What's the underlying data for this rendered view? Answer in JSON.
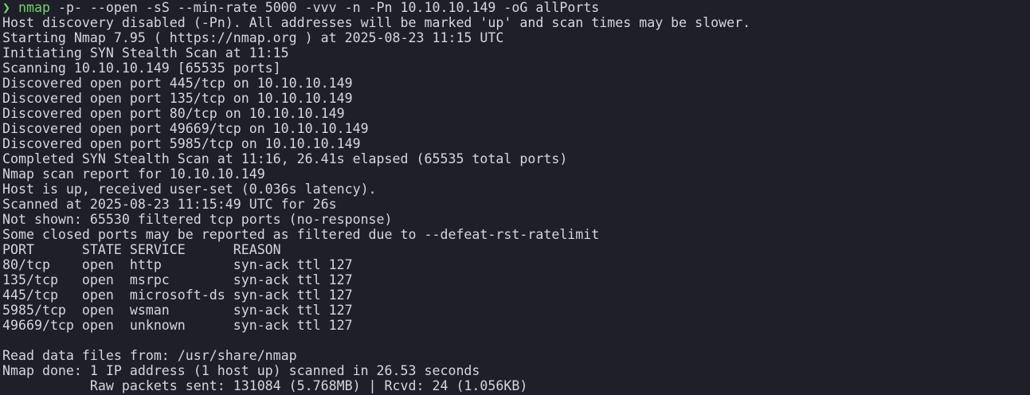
{
  "prompt": {
    "symbol": "❯",
    "command": "nmap",
    "args": " -p- --open -sS --min-rate 5000 -vvv -n -Pn 10.10.10.149 -oG allPorts"
  },
  "output_lines": [
    "Host discovery disabled (-Pn). All addresses will be marked 'up' and scan times may be slower.",
    "Starting Nmap 7.95 ( https://nmap.org ) at 2025-08-23 11:15 UTC",
    "Initiating SYN Stealth Scan at 11:15",
    "Scanning 10.10.10.149 [65535 ports]",
    "Discovered open port 445/tcp on 10.10.10.149",
    "Discovered open port 135/tcp on 10.10.10.149",
    "Discovered open port 80/tcp on 10.10.10.149",
    "Discovered open port 49669/tcp on 10.10.10.149",
    "Discovered open port 5985/tcp on 10.10.10.149",
    "Completed SYN Stealth Scan at 11:16, 26.41s elapsed (65535 total ports)",
    "Nmap scan report for 10.10.10.149",
    "Host is up, received user-set (0.036s latency).",
    "Scanned at 2025-08-23 11:15:49 UTC for 26s",
    "Not shown: 65530 filtered tcp ports (no-response)",
    "Some closed ports may be reported as filtered due to --defeat-rst-ratelimit",
    "PORT      STATE SERVICE      REASON",
    "80/tcp    open  http         syn-ack ttl 127",
    "135/tcp   open  msrpc        syn-ack ttl 127",
    "445/tcp   open  microsoft-ds syn-ack ttl 127",
    "5985/tcp  open  wsman        syn-ack ttl 127",
    "49669/tcp open  unknown      syn-ack ttl 127",
    "",
    "Read data files from: /usr/share/nmap",
    "Nmap done: 1 IP address (1 host up) scanned in 26.53 seconds",
    "           Raw packets sent: 131084 (5.768MB) | Rcvd: 24 (1.056KB)"
  ],
  "colors": {
    "background": "#1e1f29",
    "text": "#d3d7de",
    "prompt_green": "#74d36c"
  }
}
